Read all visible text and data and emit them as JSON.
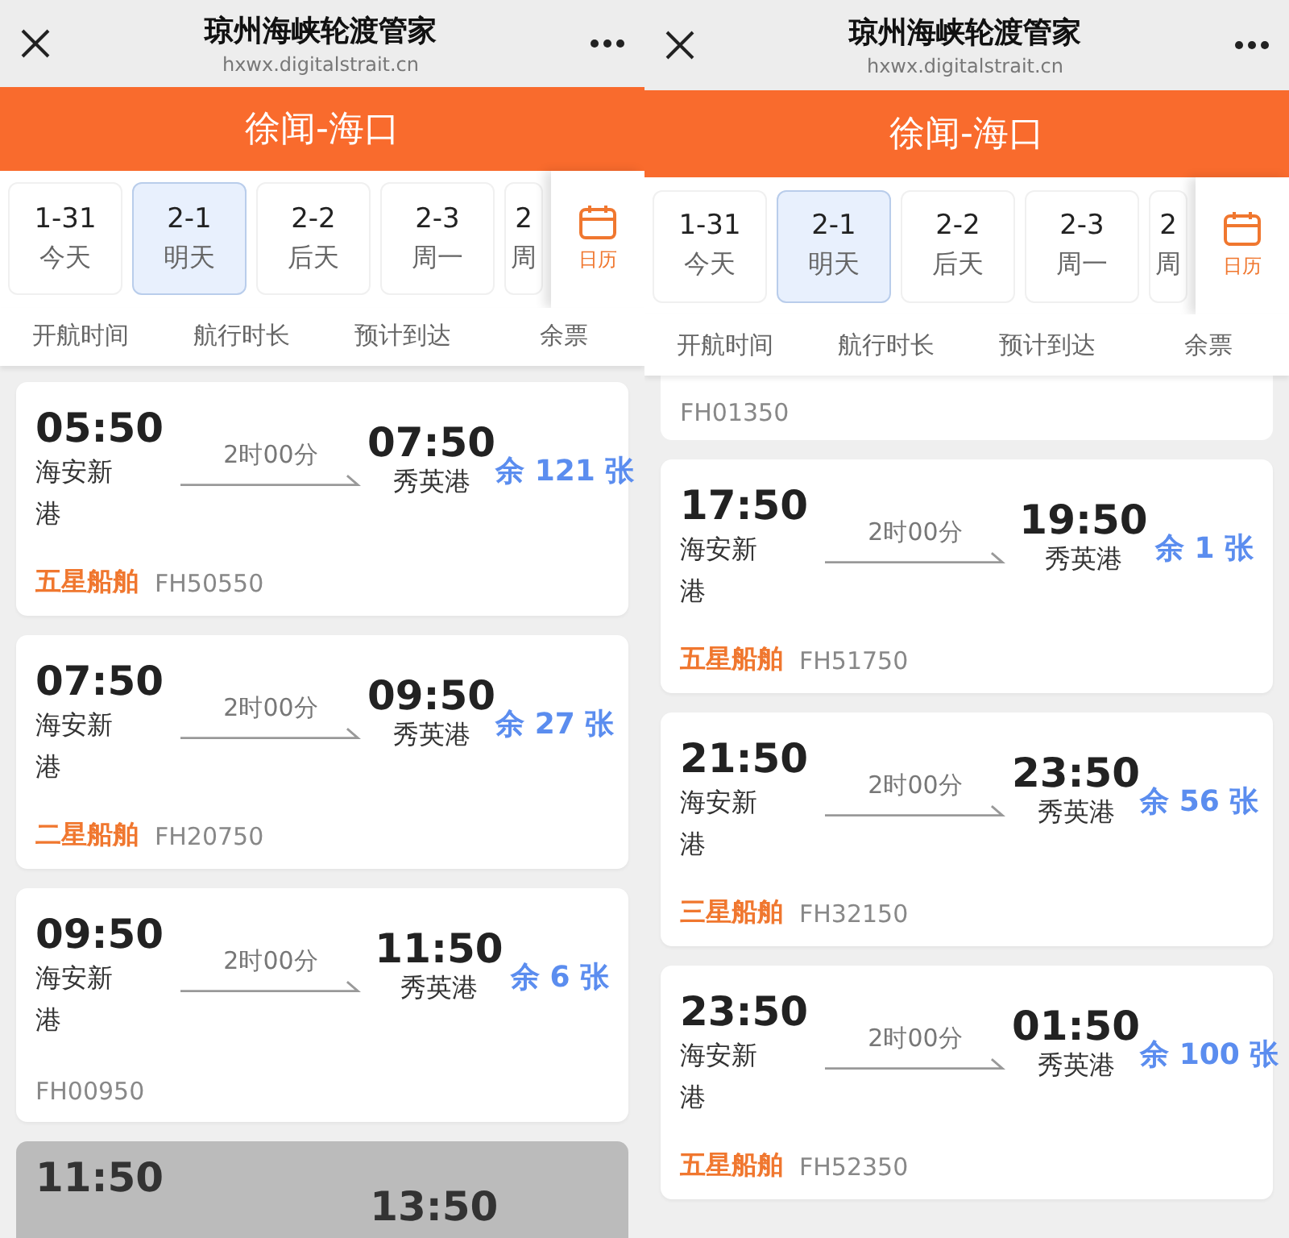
{
  "screens": [
    {
      "nav": {
        "title": "琼州海峡轮渡管家",
        "url": "hxwx.digitalstrait.cn"
      },
      "route": "徐闻-海口",
      "dates": [
        {
          "date": "1-31",
          "day": "今天",
          "selected": false
        },
        {
          "date": "2-1",
          "day": "明天",
          "selected": true
        },
        {
          "date": "2-2",
          "day": "后天",
          "selected": false
        },
        {
          "date": "2-3",
          "day": "周一",
          "selected": false
        },
        {
          "date": "2",
          "day": "周",
          "selected": false
        }
      ],
      "calendar_label": "日历",
      "columns": [
        "开航时间",
        "航行时长",
        "预计到达",
        "余票"
      ],
      "trips": [
        {
          "kind": "full",
          "dep_time": "05:50",
          "dep_port": "海安新港",
          "duration": "2时00分",
          "arr_time": "07:50",
          "arr_port": "秀英港",
          "tickets": "余 121 张",
          "ship_class": "五星船舶",
          "code": "FH50550"
        },
        {
          "kind": "full",
          "dep_time": "07:50",
          "dep_port": "海安新港",
          "duration": "2时00分",
          "arr_time": "09:50",
          "arr_port": "秀英港",
          "tickets": "余 27 张",
          "ship_class": "二星船舶",
          "code": "FH20750"
        },
        {
          "kind": "full",
          "dep_time": "09:50",
          "dep_port": "海安新港",
          "duration": "2时00分",
          "arr_time": "11:50",
          "arr_port": "秀英港",
          "tickets": "余 6 张",
          "code": "FH00950"
        },
        {
          "kind": "faded",
          "dep_time": "11:50",
          "arr_time": "13:50"
        }
      ]
    },
    {
      "nav": {
        "title": "琼州海峡轮渡管家",
        "url": "hxwx.digitalstrait.cn"
      },
      "route": "徐闻-海口",
      "dates": [
        {
          "date": "1-31",
          "day": "今天",
          "selected": false
        },
        {
          "date": "2-1",
          "day": "明天",
          "selected": true
        },
        {
          "date": "2-2",
          "day": "后天",
          "selected": false
        },
        {
          "date": "2-3",
          "day": "周一",
          "selected": false
        },
        {
          "date": "2",
          "day": "周",
          "selected": false
        }
      ],
      "calendar_label": "日历",
      "columns": [
        "开航时间",
        "航行时长",
        "预计到达",
        "余票"
      ],
      "trips": [
        {
          "kind": "tail",
          "code": "FH01350"
        },
        {
          "kind": "full",
          "dep_time": "17:50",
          "dep_port": "海安新港",
          "duration": "2时00分",
          "arr_time": "19:50",
          "arr_port": "秀英港",
          "tickets": "余 1 张",
          "ship_class": "五星船舶",
          "code": "FH51750"
        },
        {
          "kind": "full",
          "dep_time": "21:50",
          "dep_port": "海安新港",
          "duration": "2时00分",
          "arr_time": "23:50",
          "arr_port": "秀英港",
          "tickets": "余 56 张",
          "ship_class": "三星船舶",
          "code": "FH32150"
        },
        {
          "kind": "full",
          "dep_time": "23:50",
          "dep_port": "海安新港",
          "duration": "2时00分",
          "arr_time": "01:50",
          "arr_port": "秀英港",
          "tickets": "余 100 张",
          "ship_class": "五星船舶",
          "code": "FH52350"
        }
      ]
    }
  ]
}
